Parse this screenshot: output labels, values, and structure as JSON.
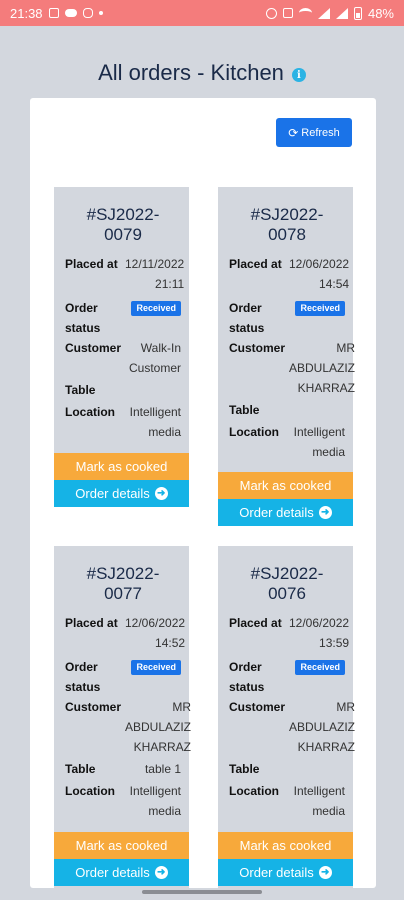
{
  "status_bar": {
    "time": "21:38",
    "battery": "48%"
  },
  "header": {
    "title": "All orders - Kitchen",
    "info_icon": "i"
  },
  "toolbar": {
    "refresh_label": "Refresh",
    "refresh_icon": "⟳"
  },
  "labels": {
    "placed_at": "Placed at",
    "order_status": "Order status",
    "customer": "Customer",
    "table": "Table",
    "location": "Location",
    "mark_cooked": "Mark as cooked",
    "order_details": "Order details",
    "details_icon": "➜"
  },
  "orders": [
    {
      "number": "#SJ2022-0079",
      "placed_at": "12/11/2022 21:11",
      "status": "Received",
      "customer": "Walk-In Customer",
      "table": "",
      "location": "Intelligent media"
    },
    {
      "number": "#SJ2022-0078",
      "placed_at": "12/06/2022 14:54",
      "status": "Received",
      "customer": "MR ABDULAZIZ KHARRAZ",
      "table": "",
      "location": "Intelligent media"
    },
    {
      "number": "#SJ2022-0077",
      "placed_at": "12/06/2022 14:52",
      "status": "Received",
      "customer": "MR ABDULAZIZ KHARRAZ",
      "table": "table 1",
      "location": "Intelligent media"
    },
    {
      "number": "#SJ2022-0076",
      "placed_at": "12/06/2022 13:59",
      "status": "Received",
      "customer": "MR ABDULAZIZ KHARRAZ",
      "table": "",
      "location": "Intelligent media"
    }
  ]
}
